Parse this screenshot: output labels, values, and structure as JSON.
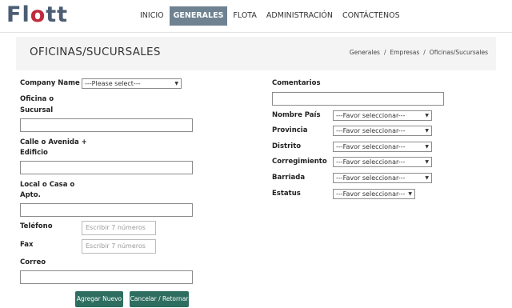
{
  "brand": {
    "name_part1": "Fl",
    "name_part2": "o",
    "name_part3": "tt",
    "color_red": "#c22a3c",
    "color_gray": "#4c5d73"
  },
  "nav": {
    "items": [
      "INICIO",
      "GENERALES",
      "FLOTA",
      "ADMINISTRACIÓN",
      "CONTÁCTENOS"
    ],
    "active": "GENERALES",
    "active_color": "#6e8291"
  },
  "page": {
    "title": "OFICINAS/SUCURSALES",
    "breadcrumb": [
      "Generales",
      "Empresas",
      "Oficinas/Sucursales"
    ],
    "breadcrumb_sep": "/"
  },
  "form": {
    "company_label": "Company Name",
    "company_select": "---Please select---",
    "oficina_label_1": "Oficina o",
    "oficina_label_2": "Sucursal",
    "calle_label_1": "Calle o Avenida +",
    "calle_label_2": "Edificio",
    "local_label_1": "Local o Casa o",
    "local_label_2": "Apto.",
    "telefono_label": "Teléfono",
    "telefono_placeholder": "Escribir 7 números",
    "fax_label": "Fax",
    "fax_placeholder": "Escribir 7 números",
    "correo_label": "Correo",
    "comentarios_label": "Comentarios",
    "pais_label": "Nombre País",
    "provincia_label": "Provincia",
    "distrito_label": "Distrito",
    "corregimiento_label": "Corregimiento",
    "barriada_label": "Barriada",
    "estatus_label": "Estatus",
    "select_default": "---Favor seleccionar---",
    "add_button": "Agregar Nuevo",
    "cancel_button": "Cancelar / Retornar",
    "button_color": "#2e6e60"
  }
}
